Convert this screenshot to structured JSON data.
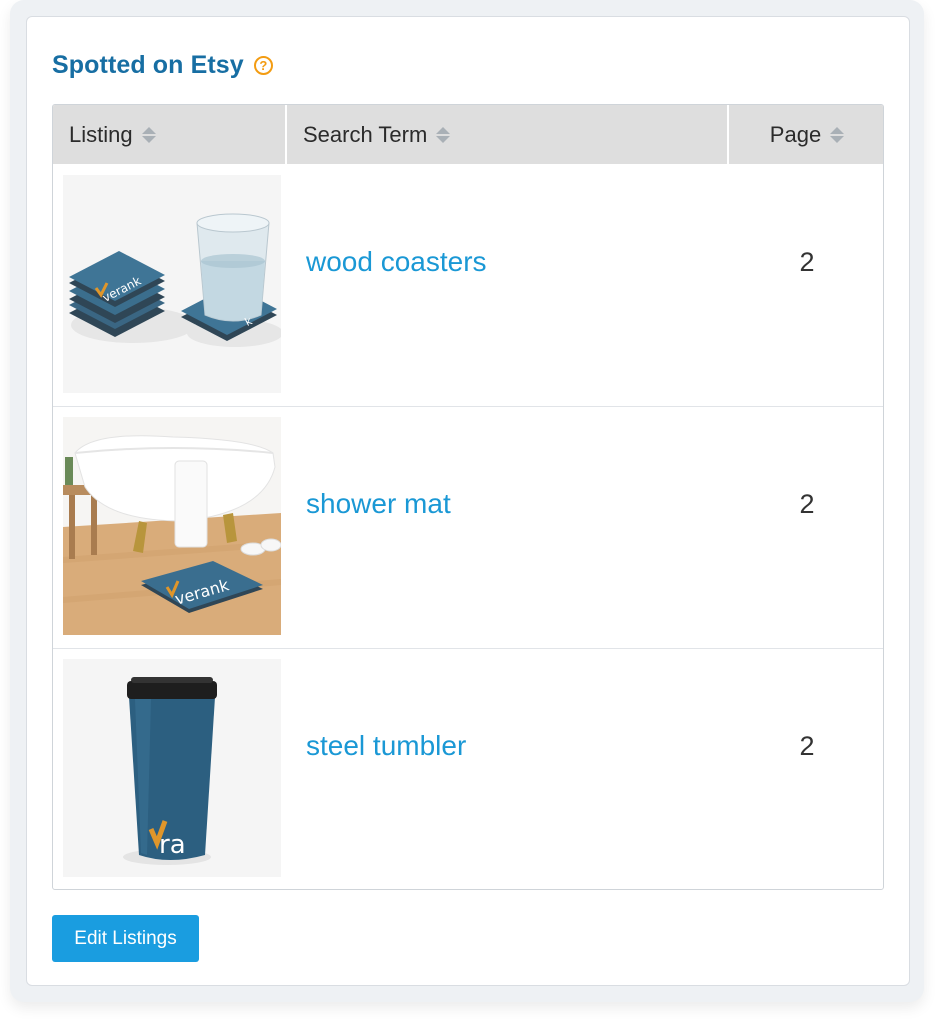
{
  "section": {
    "title": "Spotted on Etsy",
    "help_icon": "question-circle-icon",
    "accent_color": "#f39c12",
    "title_color": "#176ea3"
  },
  "table": {
    "columns": [
      {
        "label": "Listing",
        "sort_icon": "sort-icon"
      },
      {
        "label": "Search Term",
        "sort_icon": "sort-icon"
      },
      {
        "label": "Page",
        "sort_icon": "sort-icon"
      }
    ],
    "rows": [
      {
        "listing_image": "coasters-product-image",
        "search_term": "wood coasters",
        "page": "2"
      },
      {
        "listing_image": "bath-mat-product-image",
        "search_term": "shower mat",
        "page": "2"
      },
      {
        "listing_image": "tumbler-product-image",
        "search_term": "steel tumbler",
        "page": "2"
      }
    ],
    "link_color": "#1a98d5",
    "header_bg": "#dedede"
  },
  "actions": {
    "edit_label": "Edit Listings",
    "button_color": "#1a9de0"
  },
  "brand": {
    "product_logo_text": "verank"
  }
}
